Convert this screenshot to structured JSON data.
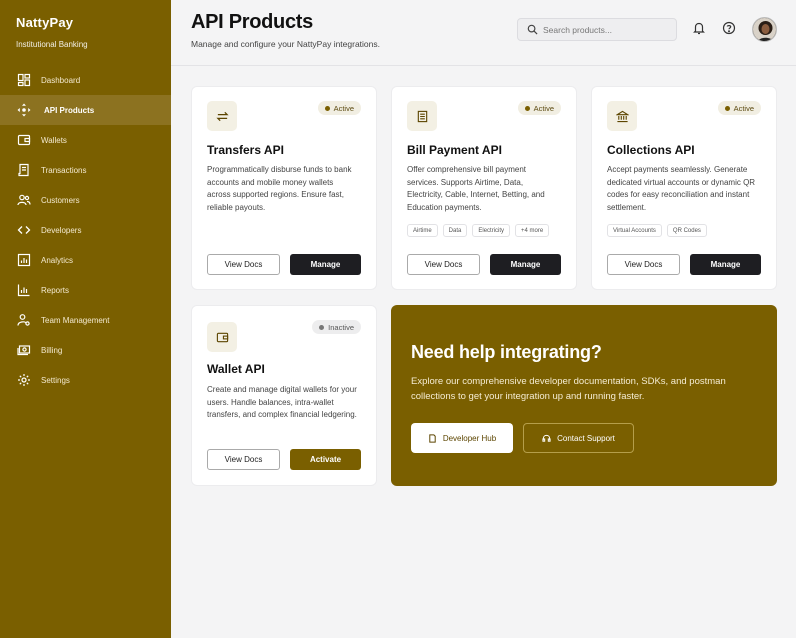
{
  "brand": {
    "name": "NattyPay",
    "subtitle": "Institutional Banking"
  },
  "nav": [
    {
      "label": "Dashboard",
      "icon": "dashboard-icon"
    },
    {
      "label": "API Products",
      "icon": "api-icon",
      "active": true
    },
    {
      "label": "Wallets",
      "icon": "wallet-icon"
    },
    {
      "label": "Transactions",
      "icon": "receipt-icon"
    },
    {
      "label": "Customers",
      "icon": "users-icon"
    },
    {
      "label": "Developers",
      "icon": "code-icon"
    },
    {
      "label": "Analytics",
      "icon": "analytics-icon"
    },
    {
      "label": "Reports",
      "icon": "reports-icon"
    },
    {
      "label": "Team Management",
      "icon": "team-icon"
    },
    {
      "label": "Billing",
      "icon": "billing-icon"
    },
    {
      "label": "Settings",
      "icon": "gear-icon"
    }
  ],
  "header": {
    "title": "API Products",
    "subtitle": "Manage and configure your NattyPay integrations.",
    "search_placeholder": "Search products..."
  },
  "products": [
    {
      "title": "Transfers API",
      "status": "Active",
      "icon": "transfer-arrows-icon",
      "description": "Programmatically disburse funds to bank accounts and mobile money wallets across supported regions. Ensure fast, reliable payouts.",
      "tags": [],
      "secondary_label": "View Docs",
      "primary_label": "Manage"
    },
    {
      "title": "Bill Payment API",
      "status": "Active",
      "icon": "bill-icon",
      "description": "Offer comprehensive bill payment services. Supports Airtime, Data, Electricity, Cable, Internet, Betting, and Education payments.",
      "tags": [
        "Airtime",
        "Data",
        "Electricity",
        "+4 more"
      ],
      "secondary_label": "View Docs",
      "primary_label": "Manage"
    },
    {
      "title": "Collections API",
      "status": "Active",
      "icon": "bank-icon",
      "description": "Accept payments seamlessly. Generate dedicated virtual accounts or dynamic QR codes for easy reconciliation and instant settlement.",
      "tags": [
        "Virtual Accounts",
        "QR Codes"
      ],
      "secondary_label": "View Docs",
      "primary_label": "Manage"
    },
    {
      "title": "Wallet API",
      "status": "Inactive",
      "icon": "wallet-icon",
      "description": "Create and manage digital wallets for your users. Handle balances, intra-wallet transfers, and complex financial ledgering.",
      "tags": [],
      "secondary_label": "View Docs",
      "primary_label": "Activate"
    }
  ],
  "help": {
    "title": "Need help integrating?",
    "text": "Explore our comprehensive developer documentation, SDKs, and postman collections to get your integration up and running faster.",
    "primary_label": "Developer Hub",
    "secondary_label": "Contact Support"
  },
  "colors": {
    "brand": "#7a5f00",
    "dark_button": "#1e1e22",
    "background": "#f4f4f5"
  }
}
